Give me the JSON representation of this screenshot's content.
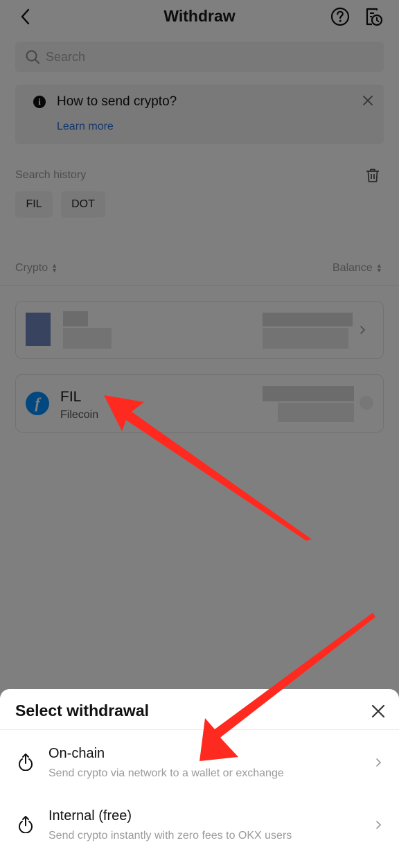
{
  "header": {
    "title": "Withdraw",
    "back_icon": "chevron-left-icon",
    "help_icon": "question-circle-icon",
    "history_icon": "history-icon"
  },
  "search": {
    "placeholder": "Search",
    "icon": "search-icon"
  },
  "banner": {
    "title": "How to send crypto?",
    "link": "Learn more",
    "info_icon": "info-icon",
    "close_icon": "close-icon"
  },
  "history": {
    "label": "Search history",
    "trash_icon": "trash-icon",
    "chips": [
      "FIL",
      "DOT"
    ]
  },
  "columns": {
    "crypto": "Crypto",
    "balance": "Balance"
  },
  "assets": [
    {
      "symbol": "",
      "name": "",
      "blurred": true
    },
    {
      "symbol": "FIL",
      "name": "Filecoin",
      "logo_glyph": "f",
      "blurred": false
    }
  ],
  "sheet": {
    "title": "Select withdrawal",
    "close_icon": "close-icon",
    "options": [
      {
        "title": "On-chain",
        "subtitle": "Send crypto via network to a wallet or exchange",
        "icon": "upload-arrow-icon"
      },
      {
        "title": "Internal (free)",
        "subtitle": "Send crypto instantly with zero fees to OKX users",
        "icon": "upload-arrow-icon"
      }
    ]
  },
  "colors": {
    "accent_link": "#2d6fd7",
    "fil_logo": "#0090ff",
    "annotation_arrow": "#ff2a1f",
    "dim_overlay": "rgba(0,0,0,0.5)"
  }
}
